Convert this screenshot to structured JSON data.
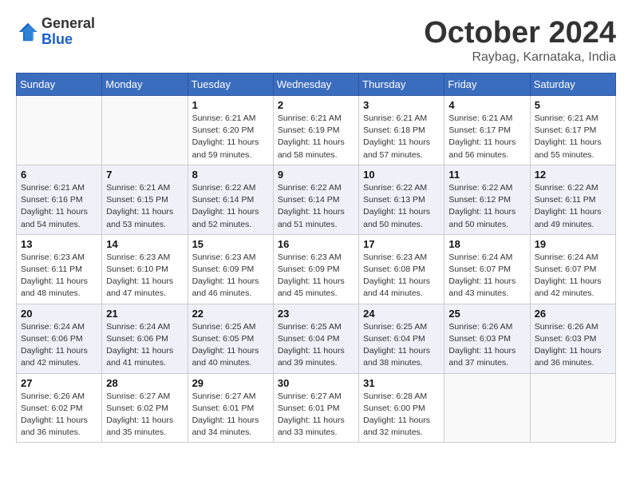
{
  "logo": {
    "general": "General",
    "blue": "Blue"
  },
  "title": {
    "month": "October 2024",
    "location": "Raybag, Karnataka, India"
  },
  "headers": [
    "Sunday",
    "Monday",
    "Tuesday",
    "Wednesday",
    "Thursday",
    "Friday",
    "Saturday"
  ],
  "weeks": [
    [
      {
        "day": "",
        "sunrise": "",
        "sunset": "",
        "daylight": ""
      },
      {
        "day": "",
        "sunrise": "",
        "sunset": "",
        "daylight": ""
      },
      {
        "day": "1",
        "sunrise": "Sunrise: 6:21 AM",
        "sunset": "Sunset: 6:20 PM",
        "daylight": "Daylight: 11 hours and 59 minutes."
      },
      {
        "day": "2",
        "sunrise": "Sunrise: 6:21 AM",
        "sunset": "Sunset: 6:19 PM",
        "daylight": "Daylight: 11 hours and 58 minutes."
      },
      {
        "day": "3",
        "sunrise": "Sunrise: 6:21 AM",
        "sunset": "Sunset: 6:18 PM",
        "daylight": "Daylight: 11 hours and 57 minutes."
      },
      {
        "day": "4",
        "sunrise": "Sunrise: 6:21 AM",
        "sunset": "Sunset: 6:17 PM",
        "daylight": "Daylight: 11 hours and 56 minutes."
      },
      {
        "day": "5",
        "sunrise": "Sunrise: 6:21 AM",
        "sunset": "Sunset: 6:17 PM",
        "daylight": "Daylight: 11 hours and 55 minutes."
      }
    ],
    [
      {
        "day": "6",
        "sunrise": "Sunrise: 6:21 AM",
        "sunset": "Sunset: 6:16 PM",
        "daylight": "Daylight: 11 hours and 54 minutes."
      },
      {
        "day": "7",
        "sunrise": "Sunrise: 6:21 AM",
        "sunset": "Sunset: 6:15 PM",
        "daylight": "Daylight: 11 hours and 53 minutes."
      },
      {
        "day": "8",
        "sunrise": "Sunrise: 6:22 AM",
        "sunset": "Sunset: 6:14 PM",
        "daylight": "Daylight: 11 hours and 52 minutes."
      },
      {
        "day": "9",
        "sunrise": "Sunrise: 6:22 AM",
        "sunset": "Sunset: 6:14 PM",
        "daylight": "Daylight: 11 hours and 51 minutes."
      },
      {
        "day": "10",
        "sunrise": "Sunrise: 6:22 AM",
        "sunset": "Sunset: 6:13 PM",
        "daylight": "Daylight: 11 hours and 50 minutes."
      },
      {
        "day": "11",
        "sunrise": "Sunrise: 6:22 AM",
        "sunset": "Sunset: 6:12 PM",
        "daylight": "Daylight: 11 hours and 50 minutes."
      },
      {
        "day": "12",
        "sunrise": "Sunrise: 6:22 AM",
        "sunset": "Sunset: 6:11 PM",
        "daylight": "Daylight: 11 hours and 49 minutes."
      }
    ],
    [
      {
        "day": "13",
        "sunrise": "Sunrise: 6:23 AM",
        "sunset": "Sunset: 6:11 PM",
        "daylight": "Daylight: 11 hours and 48 minutes."
      },
      {
        "day": "14",
        "sunrise": "Sunrise: 6:23 AM",
        "sunset": "Sunset: 6:10 PM",
        "daylight": "Daylight: 11 hours and 47 minutes."
      },
      {
        "day": "15",
        "sunrise": "Sunrise: 6:23 AM",
        "sunset": "Sunset: 6:09 PM",
        "daylight": "Daylight: 11 hours and 46 minutes."
      },
      {
        "day": "16",
        "sunrise": "Sunrise: 6:23 AM",
        "sunset": "Sunset: 6:09 PM",
        "daylight": "Daylight: 11 hours and 45 minutes."
      },
      {
        "day": "17",
        "sunrise": "Sunrise: 6:23 AM",
        "sunset": "Sunset: 6:08 PM",
        "daylight": "Daylight: 11 hours and 44 minutes."
      },
      {
        "day": "18",
        "sunrise": "Sunrise: 6:24 AM",
        "sunset": "Sunset: 6:07 PM",
        "daylight": "Daylight: 11 hours and 43 minutes."
      },
      {
        "day": "19",
        "sunrise": "Sunrise: 6:24 AM",
        "sunset": "Sunset: 6:07 PM",
        "daylight": "Daylight: 11 hours and 42 minutes."
      }
    ],
    [
      {
        "day": "20",
        "sunrise": "Sunrise: 6:24 AM",
        "sunset": "Sunset: 6:06 PM",
        "daylight": "Daylight: 11 hours and 42 minutes."
      },
      {
        "day": "21",
        "sunrise": "Sunrise: 6:24 AM",
        "sunset": "Sunset: 6:06 PM",
        "daylight": "Daylight: 11 hours and 41 minutes."
      },
      {
        "day": "22",
        "sunrise": "Sunrise: 6:25 AM",
        "sunset": "Sunset: 6:05 PM",
        "daylight": "Daylight: 11 hours and 40 minutes."
      },
      {
        "day": "23",
        "sunrise": "Sunrise: 6:25 AM",
        "sunset": "Sunset: 6:04 PM",
        "daylight": "Daylight: 11 hours and 39 minutes."
      },
      {
        "day": "24",
        "sunrise": "Sunrise: 6:25 AM",
        "sunset": "Sunset: 6:04 PM",
        "daylight": "Daylight: 11 hours and 38 minutes."
      },
      {
        "day": "25",
        "sunrise": "Sunrise: 6:26 AM",
        "sunset": "Sunset: 6:03 PM",
        "daylight": "Daylight: 11 hours and 37 minutes."
      },
      {
        "day": "26",
        "sunrise": "Sunrise: 6:26 AM",
        "sunset": "Sunset: 6:03 PM",
        "daylight": "Daylight: 11 hours and 36 minutes."
      }
    ],
    [
      {
        "day": "27",
        "sunrise": "Sunrise: 6:26 AM",
        "sunset": "Sunset: 6:02 PM",
        "daylight": "Daylight: 11 hours and 36 minutes."
      },
      {
        "day": "28",
        "sunrise": "Sunrise: 6:27 AM",
        "sunset": "Sunset: 6:02 PM",
        "daylight": "Daylight: 11 hours and 35 minutes."
      },
      {
        "day": "29",
        "sunrise": "Sunrise: 6:27 AM",
        "sunset": "Sunset: 6:01 PM",
        "daylight": "Daylight: 11 hours and 34 minutes."
      },
      {
        "day": "30",
        "sunrise": "Sunrise: 6:27 AM",
        "sunset": "Sunset: 6:01 PM",
        "daylight": "Daylight: 11 hours and 33 minutes."
      },
      {
        "day": "31",
        "sunrise": "Sunrise: 6:28 AM",
        "sunset": "Sunset: 6:00 PM",
        "daylight": "Daylight: 11 hours and 32 minutes."
      },
      {
        "day": "",
        "sunrise": "",
        "sunset": "",
        "daylight": ""
      },
      {
        "day": "",
        "sunrise": "",
        "sunset": "",
        "daylight": ""
      }
    ]
  ]
}
